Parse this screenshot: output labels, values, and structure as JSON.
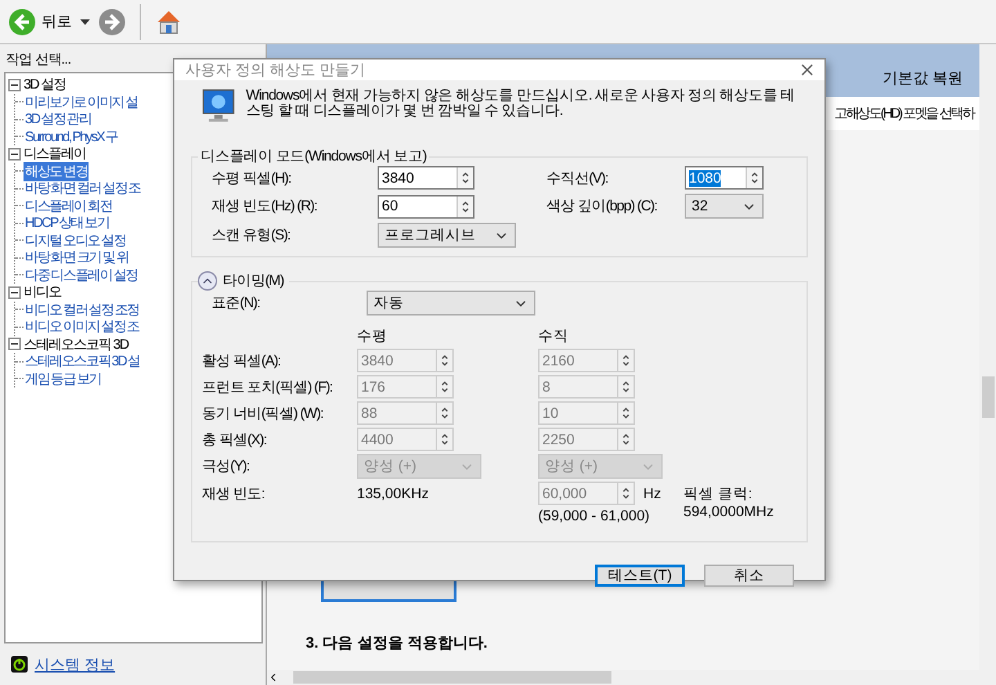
{
  "toolbar": {
    "back_label": "뒤로"
  },
  "sidebar": {
    "title": "작업 선택...",
    "tree": [
      {
        "label": "3D 설정",
        "expanded": true,
        "children": [
          {
            "label": "미리보기로 이미지 설",
            "selected": false
          },
          {
            "label": "3D 설정 관리",
            "selected": false
          },
          {
            "label": "Surround, PhysX 구",
            "selected": false
          }
        ]
      },
      {
        "label": "디스플레이",
        "expanded": true,
        "children": [
          {
            "label": "해상도 변경",
            "selected": true
          },
          {
            "label": "바탕 화면 컬러 설정 조",
            "selected": false
          },
          {
            "label": "디스플레이 회전",
            "selected": false
          },
          {
            "label": "HDCP 상태 보기",
            "selected": false
          },
          {
            "label": "디지털 오디오 설정",
            "selected": false
          },
          {
            "label": "바탕 화면 크기 및 위",
            "selected": false
          },
          {
            "label": "다중 디스플레이 설정",
            "selected": false
          }
        ]
      },
      {
        "label": "비디오",
        "expanded": true,
        "children": [
          {
            "label": "비디오 컬러 설정 조정",
            "selected": false
          },
          {
            "label": "비디오 이미지 설정 조",
            "selected": false
          }
        ]
      },
      {
        "label": "스테레오스코픽 3D",
        "expanded": true,
        "children": [
          {
            "label": "스테레오스코픽 3D 설",
            "selected": false
          },
          {
            "label": "게임 등급 보기",
            "selected": false
          }
        ]
      }
    ],
    "footer_link": "시스템 정보"
  },
  "content": {
    "restore_defaults": "기본값 복원",
    "description_fragment": "고해상도(HD) 포멧을 선택하",
    "step3": "3. 다음 설정을 적용합니다."
  },
  "dialog": {
    "title": "사용자 정의 해상도 만들기",
    "message": "Windows에서 현재 가능하지 않은 해상도를 만드십시오. 새로운 사용자 정의 해상도를 테스팅 할 때 디스플레이가 몇 번 깜박일 수 있습니다.",
    "mode_group": {
      "title": "디스플레이 모드(Windows에서 보고)",
      "fields": [
        {
          "kind": "spin",
          "label": "수평 픽셀(H):",
          "value": "3840",
          "text_selected": false
        },
        {
          "kind": "spin",
          "label": "수직선(V):",
          "value": "1080",
          "text_selected": true
        },
        {
          "kind": "spin",
          "label": "재생 빈도(Hz) (R):",
          "value": "60",
          "text_selected": false
        },
        {
          "kind": "dropdown",
          "label": "색상 깊이(bpp) (C):",
          "value": "32"
        },
        {
          "kind": "dropdown",
          "label": "스캔 유형(S):",
          "value": "프로그레시브"
        }
      ]
    },
    "timing": {
      "title": "타이밍(M)",
      "expanded": true,
      "standard": {
        "label": "표준(N):",
        "value": "자동"
      },
      "column_headers": [
        "수평",
        "수직"
      ],
      "rows": [
        {
          "label": "활성 픽셀(A):",
          "horizontal": "3840",
          "vertical": "2160",
          "disabled": true
        },
        {
          "label": "프런트 포치(픽셀) (F):",
          "horizontal": "176",
          "vertical": "8",
          "disabled": true
        },
        {
          "label": "동기 너비(픽셀) (W):",
          "horizontal": "88",
          "vertical": "10",
          "disabled": true
        },
        {
          "label": "총 픽셀(X):",
          "horizontal": "4400",
          "vertical": "2250",
          "disabled": true
        }
      ],
      "polarity": {
        "label": "극성(Y):",
        "horizontal": "양성 (+)",
        "vertical": "양성 (+)",
        "disabled": true
      },
      "refresh": {
        "label": "재생 빈도:",
        "horizontal": "135,00KHz",
        "vertical": "60,000",
        "disabled": true,
        "unit": "Hz",
        "range": "(59,000 - 61,000)"
      },
      "pixel_clock": {
        "label": "픽셀 클럭:",
        "value": "594,0000MHz"
      }
    },
    "buttons": [
      {
        "label": "테스트(T)",
        "default": true
      },
      {
        "label": "취소",
        "default": false
      }
    ]
  }
}
